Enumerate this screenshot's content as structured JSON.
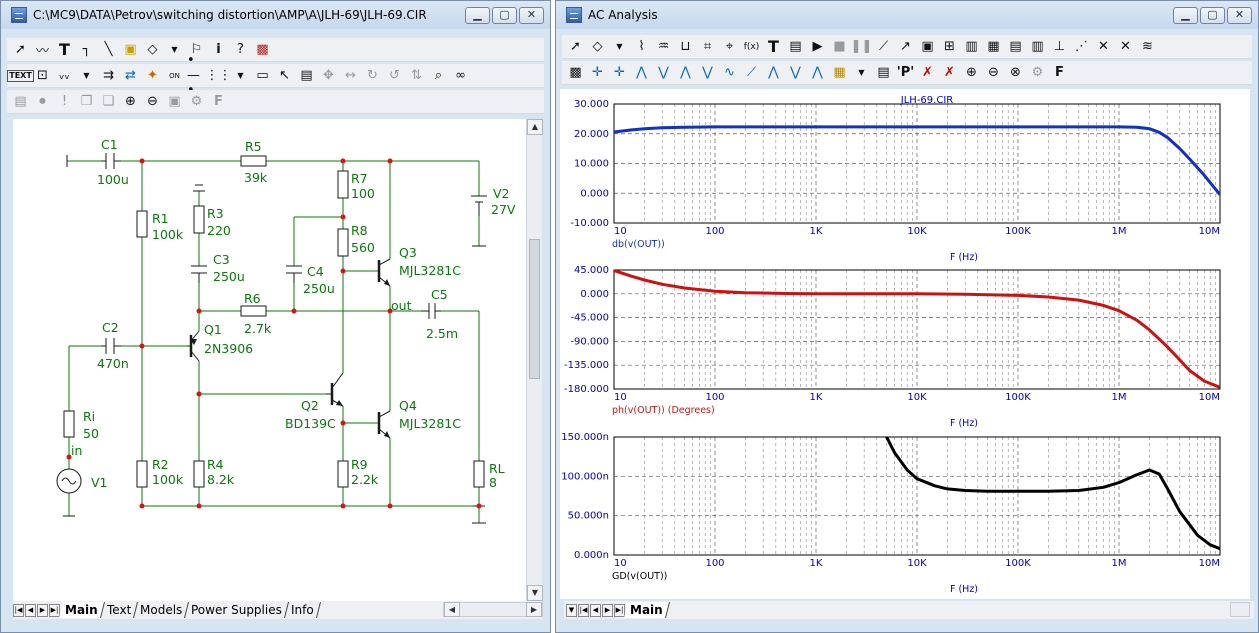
{
  "left_window": {
    "title": "C:\\MC9\\DATA\\Petrov\\switching distortion\\AMP\\A\\JLH-69\\JLH-69.CIR",
    "tabs": [
      {
        "label": "Main",
        "active": true
      },
      {
        "label": "Text",
        "active": false
      },
      {
        "label": "Models",
        "active": false
      },
      {
        "label": "Power Supplies",
        "active": false
      },
      {
        "label": "Info",
        "active": false
      }
    ],
    "toolbar_text_icon": "TEXT"
  },
  "schematic": {
    "labels": {
      "c1_name": "C1",
      "c1_val": "100u",
      "r5_name": "R5",
      "r5_val": "39k",
      "r7_name": "R7",
      "r7_val": "100",
      "r8_name": "R8",
      "r8_val": "560",
      "v2_name": "V2",
      "v2_val": "27V",
      "r1_name": "R1",
      "r1_val": "100k",
      "r3_name": "R3",
      "r3_val": "220",
      "c3_name": "C3",
      "c3_val": "250u",
      "c4_name": "C4",
      "c4_val": "250u",
      "q3_name": "Q3",
      "q3_val": "MJL3281C",
      "r6_name": "R6",
      "r6_val": "2.7k",
      "out_label": "out",
      "c5_name": "C5",
      "c5_val": "2.5m",
      "c2_name": "C2",
      "c2_val": "470n",
      "q1_name": "Q1",
      "q1_val": "2N3906",
      "q2_name": "Q2",
      "q2_val": "BD139C",
      "q4_name": "Q4",
      "q4_val": "MJL3281C",
      "ri_name": "Ri",
      "ri_val": "50",
      "in_label": "in",
      "v1_name": "V1",
      "r2_name": "R2",
      "r2_val": "100k",
      "r4_name": "R4",
      "r4_val": "8.2k",
      "r9_name": "R9",
      "r9_val": "2.2k",
      "rl_name": "RL",
      "rl_val": "8"
    }
  },
  "right_window": {
    "title": "AC Analysis",
    "tabs": [
      {
        "label": "Main",
        "active": true
      }
    ],
    "toolbar_f_icon": "F",
    "toolbar_p_icon": "'P'"
  },
  "chart_data": [
    {
      "type": "line",
      "title": "JLH-69.CIR",
      "xlabel": "F (Hz)",
      "ylabel": "db(v(OUT))",
      "x_scale": "log",
      "xlim": [
        10,
        10000000
      ],
      "ylim": [
        -10,
        30
      ],
      "x_tick_labels": [
        "10",
        "100",
        "1K",
        "10K",
        "100K",
        "1M",
        "10M"
      ],
      "y_tick_labels": [
        "30.000",
        "20.000",
        "10.000",
        "0.000",
        "-10.000"
      ],
      "y_ticks": [
        30,
        20,
        10,
        0,
        -10
      ],
      "grid": true,
      "color": "#1030c8",
      "series": [
        {
          "name": "db(v(OUT))",
          "x": [
            10,
            15,
            20,
            30,
            50,
            100,
            1000,
            10000,
            100000,
            1000000,
            1500000,
            2000000,
            2500000,
            3000000,
            4000000,
            5000000,
            7000000,
            10000000
          ],
          "y": [
            20.6,
            21.3,
            21.7,
            22.0,
            22.2,
            22.3,
            22.3,
            22.3,
            22.3,
            22.3,
            22.2,
            21.7,
            20.5,
            18.8,
            15.0,
            11.5,
            6.0,
            -0.5
          ]
        }
      ]
    },
    {
      "type": "line",
      "title": "",
      "xlabel": "F (Hz)",
      "ylabel": "ph(v(OUT)) (Degrees)",
      "x_scale": "log",
      "xlim": [
        10,
        10000000
      ],
      "ylim": [
        -180,
        45
      ],
      "x_tick_labels": [
        "10",
        "100",
        "1K",
        "10K",
        "100K",
        "1M",
        "10M"
      ],
      "y_tick_labels": [
        "45.000",
        "0.000",
        "-45.000",
        "-90.000",
        "-135.000",
        "-180.000"
      ],
      "y_ticks": [
        45,
        0,
        -45,
        -90,
        -135,
        -180
      ],
      "grid": true,
      "color": "#d01010",
      "series": [
        {
          "name": "ph(v(OUT)) (Degrees)",
          "x": [
            10,
            15,
            20,
            30,
            50,
            100,
            200,
            500,
            1000,
            10000,
            30000,
            100000,
            200000,
            400000,
            700000,
            1000000,
            1500000,
            2000000,
            3000000,
            4000000,
            5000000,
            7000000,
            10000000
          ],
          "y": [
            44,
            33,
            26,
            18,
            11,
            5,
            2,
            0.5,
            0,
            0,
            -1,
            -3,
            -6,
            -12,
            -22,
            -32,
            -50,
            -68,
            -100,
            -125,
            -145,
            -165,
            -177
          ]
        }
      ]
    },
    {
      "type": "line",
      "title": "",
      "xlabel": "F (Hz)",
      "ylabel": "GD(v(OUT))",
      "x_scale": "log",
      "xlim": [
        10,
        10000000
      ],
      "ylim": [
        0,
        150
      ],
      "x_tick_labels": [
        "10",
        "100",
        "1K",
        "10K",
        "100K",
        "1M",
        "10M"
      ],
      "y_tick_labels": [
        "150.000n",
        "100.000n",
        "50.000n",
        "0.000n"
      ],
      "y_ticks": [
        150,
        100,
        50,
        0
      ],
      "y_unit": "n",
      "grid": true,
      "color": "#000000",
      "series": [
        {
          "name": "GD(v(OUT))",
          "x": [
            5000,
            6000,
            8000,
            10000,
            15000,
            20000,
            30000,
            50000,
            100000,
            200000,
            400000,
            700000,
            1000000,
            1500000,
            2000000,
            2500000,
            3000000,
            4000000,
            6000000,
            8000000,
            10000000
          ],
          "y": [
            150,
            130,
            108,
            97,
            88,
            84,
            82,
            81,
            81,
            81,
            82,
            86,
            92,
            102,
            108,
            103,
            85,
            55,
            25,
            13,
            8
          ]
        }
      ]
    }
  ]
}
